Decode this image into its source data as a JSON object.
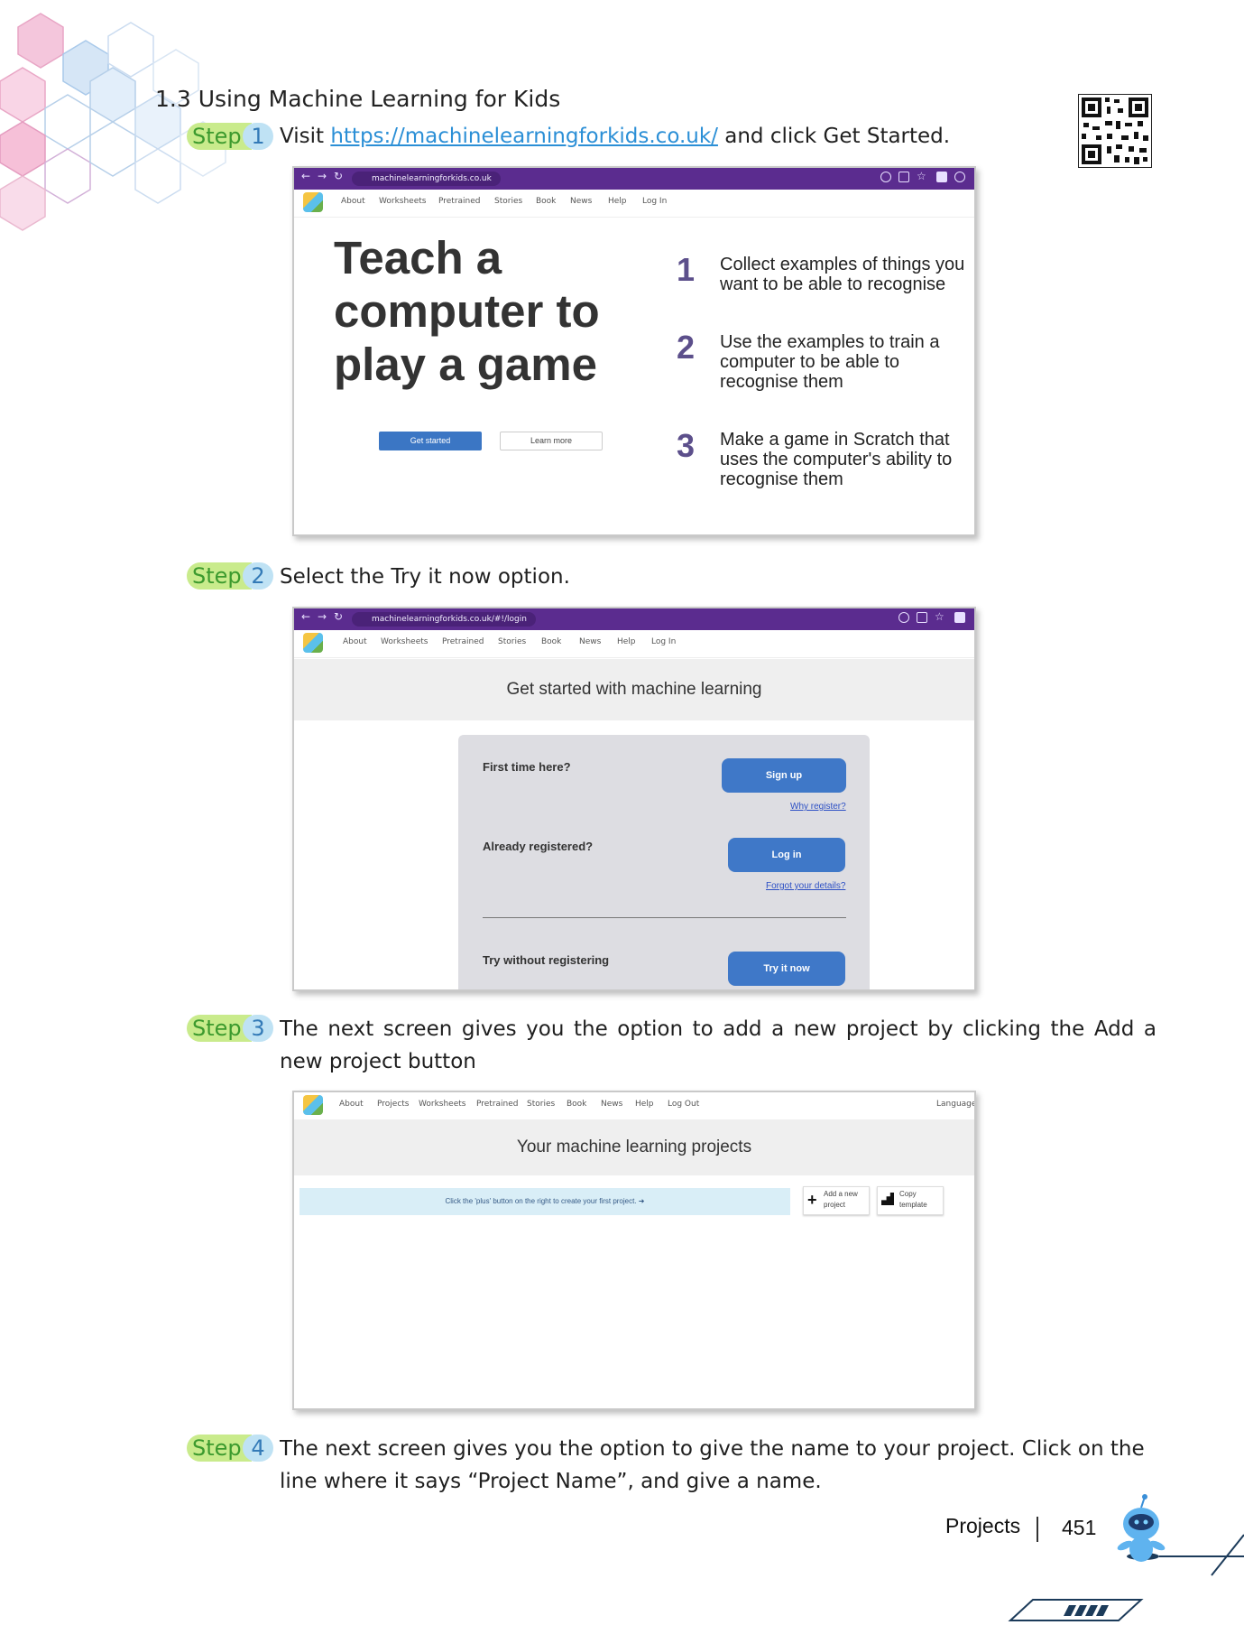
{
  "section_title": "1.3 Using Machine Learning for Kids",
  "steps": [
    {
      "label": "Step",
      "number": "1",
      "text_before": "Visit ",
      "link": "https://machinelearningforkids.co.uk/",
      "text_after": " and click Get Started."
    },
    {
      "label": "Step",
      "number": "2",
      "text": "Select the Try it now option."
    },
    {
      "label": "Step",
      "number": "3",
      "text": "The next screen gives you the option to add a new project by clicking the Add a new project button"
    },
    {
      "label": "Step",
      "number": "4",
      "text": "The next screen gives you the option to give the name to your project. Click on the line where it says “Project Name”, and give a name."
    }
  ],
  "screenshot1": {
    "url": "machinelearningforkids.co.uk",
    "nav": [
      "About",
      "Worksheets",
      "Pretrained",
      "Stories",
      "Book",
      "News",
      "Help",
      "Log In"
    ],
    "hero_lines": [
      "Teach a",
      "computer to",
      "play a game"
    ],
    "get_started": "Get started",
    "learn_more": "Learn more",
    "list": [
      {
        "num": "1",
        "lines": [
          "Collect examples of things you",
          "want to be able to recognise"
        ]
      },
      {
        "num": "2",
        "lines": [
          "Use the examples to train a",
          "computer to be able to",
          "recognise them"
        ]
      },
      {
        "num": "3",
        "lines": [
          "Make a game in Scratch that",
          "uses the computer's ability to",
          "recognise them"
        ]
      }
    ]
  },
  "screenshot2": {
    "url": "machinelearningforkids.co.uk/#!/login",
    "nav": [
      "About",
      "Worksheets",
      "Pretrained",
      "Stories",
      "Book",
      "News",
      "Help",
      "Log In"
    ],
    "banner": "Get started with machine learning",
    "first_time": "First time here?",
    "sign_up": "Sign up",
    "why_register": "Why register?",
    "already": "Already registered?",
    "log_in": "Log in",
    "forgot": "Forgot your details?",
    "try_without": "Try without registering",
    "try_now": "Try it now"
  },
  "screenshot3": {
    "nav": [
      "About",
      "Projects",
      "Worksheets",
      "Pretrained",
      "Stories",
      "Book",
      "News",
      "Help",
      "Log Out"
    ],
    "language": "Language",
    "banner": "Your machine learning projects",
    "hint": "Click the 'plus' button on the right to create your first project. ➜",
    "add_line1": "Add a new",
    "add_line2": "project",
    "copy_line1": "Copy",
    "copy_line2": "template"
  },
  "footer": {
    "label": "Projects",
    "page": "451"
  },
  "colors": {
    "step_green": "#c9eb8c",
    "step_blue": "#bfe2f4",
    "chrome_purple": "#5b2c8f",
    "button_blue": "#3b76c4"
  }
}
